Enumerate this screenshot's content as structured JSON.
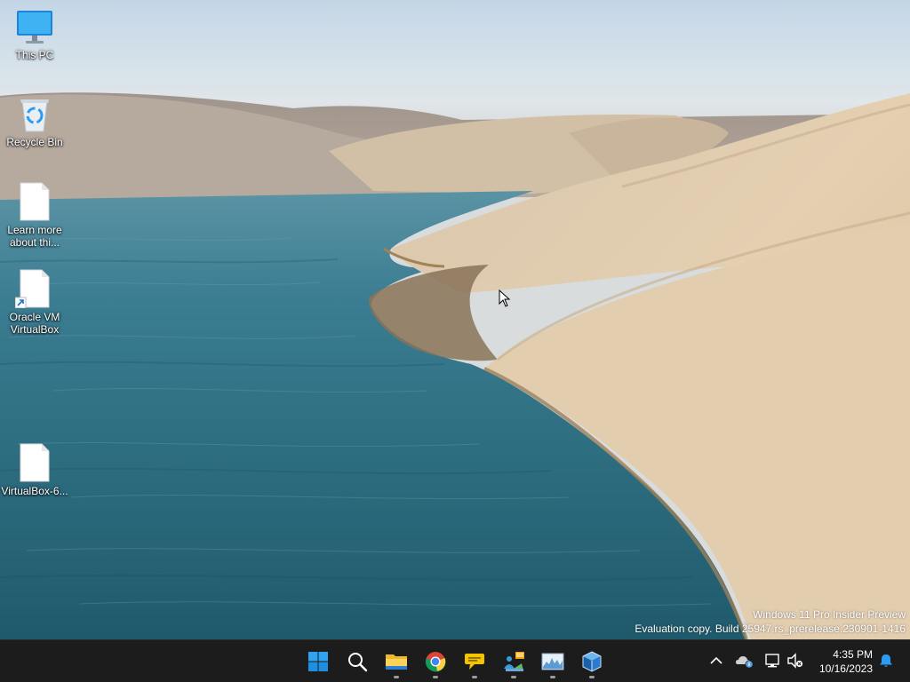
{
  "desktop": {
    "icons": [
      {
        "label": "This PC",
        "icon": "monitor-icon"
      },
      {
        "label": "Recycle Bin",
        "icon": "recycle-bin-icon"
      },
      {
        "label": "Learn more about thi...",
        "icon": "file-icon"
      },
      {
        "label": "Oracle VM VirtualBox",
        "icon": "shortcut-file-icon"
      },
      {
        "label": "VirtualBox-6...",
        "icon": "file-icon"
      }
    ],
    "watermark": {
      "line1": "Windows 11 Pro Insider Preview",
      "line2": "Evaluation copy. Build 25947.rs_prerelease.230901-1416"
    }
  },
  "taskbar": {
    "apps": [
      {
        "icon": "windows-start-icon",
        "running": false
      },
      {
        "icon": "search-icon",
        "running": false
      },
      {
        "icon": "file-explorer-icon",
        "running": true
      },
      {
        "icon": "chrome-icon",
        "running": true
      },
      {
        "icon": "chat-bubble-icon",
        "running": true
      },
      {
        "icon": "network-app-icon",
        "running": true
      },
      {
        "icon": "resource-monitor-icon",
        "running": true
      },
      {
        "icon": "virtualbox-cube-icon",
        "running": true
      }
    ],
    "tray": {
      "icons": [
        "chevron-up-icon",
        "onedrive-info-icon",
        "network-icon",
        "volume-muted-icon",
        "notification-bell-icon"
      ],
      "time": "4:35 PM",
      "date": "10/16/2023"
    }
  },
  "colors": {
    "taskbar_bg": "#1c1c1c",
    "accent": "#2d9bf0"
  }
}
